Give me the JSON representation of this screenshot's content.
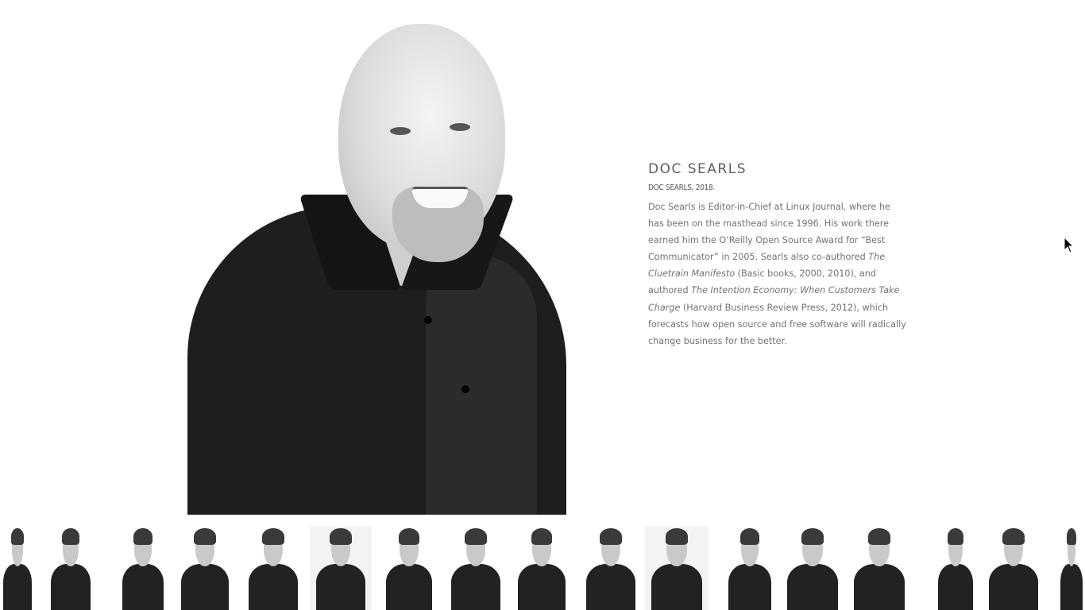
{
  "profile": {
    "name": "DOC SEARLS",
    "caption": "DOC SEARLS, 2018.",
    "bio_parts": [
      {
        "text": "Doc Searls is Editor-in-Chief at Linux Journal, where he has been on the masthead since 1996. His work there earned him the O’Reilly Open Source Award for “Best Communicator” in 2005. Searls also co-authored ",
        "italic": false
      },
      {
        "text": "The Cluetrain Manifesto",
        "italic": true
      },
      {
        "text": " (Basic books, 2000, 2010), and authored ",
        "italic": false
      },
      {
        "text": "The Intention Economy: When Customers Take Charge",
        "italic": true
      },
      {
        "text": " (Harvard Business Review Press, 2012), which forecasts how open source and free software will radically change business for the better.",
        "italic": false
      }
    ]
  },
  "colors": {
    "background": "#ffffff",
    "heading": "#5e5e5e",
    "body_text": "#737373"
  },
  "thumbnails": [
    {
      "icon": "portrait-thumbnail"
    },
    {
      "icon": "portrait-thumbnail"
    },
    {
      "icon": "portrait-thumbnail"
    },
    {
      "icon": "portrait-thumbnail"
    },
    {
      "icon": "portrait-thumbnail"
    },
    {
      "icon": "portrait-thumbnail"
    },
    {
      "icon": "portrait-thumbnail"
    },
    {
      "icon": "portrait-thumbnail"
    },
    {
      "icon": "portrait-thumbnail"
    },
    {
      "icon": "portrait-thumbnail"
    },
    {
      "icon": "portrait-thumbnail"
    },
    {
      "icon": "portrait-thumbnail"
    },
    {
      "icon": "portrait-thumbnail"
    },
    {
      "icon": "portrait-thumbnail"
    },
    {
      "icon": "portrait-thumbnail"
    },
    {
      "icon": "portrait-thumbnail"
    },
    {
      "icon": "portrait-thumbnail"
    }
  ]
}
